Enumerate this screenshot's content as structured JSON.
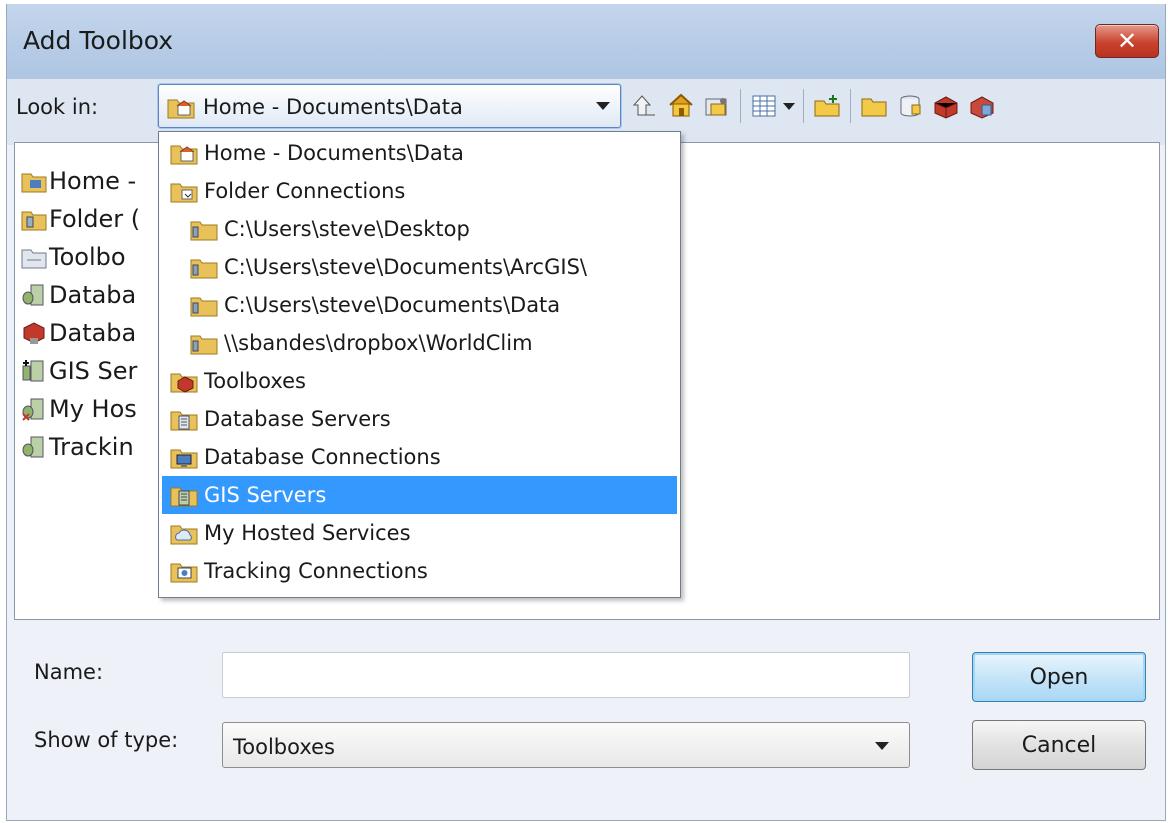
{
  "window": {
    "title": "Add Toolbox",
    "close_glyph": "✕"
  },
  "toolbar": {
    "look_in_label": "Look in:",
    "look_in_value": "Home - Documents\\Data",
    "icons": [
      "up-folder-icon",
      "home-icon",
      "connect-folder-icon",
      "view-list-icon",
      "new-folder-icon",
      "folder-icon",
      "database-icon",
      "toolbox-icon",
      "server-icon"
    ]
  },
  "list_pane": {
    "items": [
      {
        "label": "Home -",
        "icon": "home-folder-icon"
      },
      {
        "label": "Folder (",
        "icon": "folder-connections-icon"
      },
      {
        "label": "Toolbo",
        "icon": "toolboxes-icon"
      },
      {
        "label": "Databa",
        "icon": "database-servers-icon"
      },
      {
        "label": "Databa",
        "icon": "database-connections-icon"
      },
      {
        "label": "GIS Ser",
        "icon": "gis-servers-icon"
      },
      {
        "label": "My Hos",
        "icon": "hosted-services-icon"
      },
      {
        "label": "Trackin",
        "icon": "tracking-connections-icon"
      }
    ]
  },
  "dropdown": {
    "items": [
      {
        "label": "Home - Documents\\Data",
        "indent": 0,
        "icon": "home-folder-icon",
        "selected": false
      },
      {
        "label": "Folder Connections",
        "indent": 0,
        "icon": "folder-connections-icon",
        "selected": false
      },
      {
        "label": "C:\\Users\\steve\\Desktop",
        "indent": 1,
        "icon": "folder-icon",
        "selected": false
      },
      {
        "label": "C:\\Users\\steve\\Documents\\ArcGIS\\",
        "indent": 1,
        "icon": "folder-icon",
        "selected": false
      },
      {
        "label": "C:\\Users\\steve\\Documents\\Data",
        "indent": 1,
        "icon": "folder-icon",
        "selected": false
      },
      {
        "label": "\\\\sbandes\\dropbox\\WorldClim",
        "indent": 1,
        "icon": "folder-icon",
        "selected": false
      },
      {
        "label": "Toolboxes",
        "indent": 0,
        "icon": "toolboxes-icon",
        "selected": false
      },
      {
        "label": "Database Servers",
        "indent": 0,
        "icon": "database-servers-icon",
        "selected": false
      },
      {
        "label": "Database Connections",
        "indent": 0,
        "icon": "database-connections-icon",
        "selected": false
      },
      {
        "label": "GIS Servers",
        "indent": 0,
        "icon": "gis-servers-icon",
        "selected": true
      },
      {
        "label": "My Hosted Services",
        "indent": 0,
        "icon": "hosted-services-icon",
        "selected": false
      },
      {
        "label": "Tracking Connections",
        "indent": 0,
        "icon": "tracking-connections-icon",
        "selected": false
      }
    ]
  },
  "form": {
    "name_label": "Name:",
    "name_value": "",
    "type_label": "Show of type:",
    "type_value": "Toolboxes"
  },
  "buttons": {
    "open": "Open",
    "cancel": "Cancel"
  },
  "colors": {
    "selection": "#3399ff",
    "titlebar": "#b5cbe6",
    "close": "#c9432f"
  }
}
